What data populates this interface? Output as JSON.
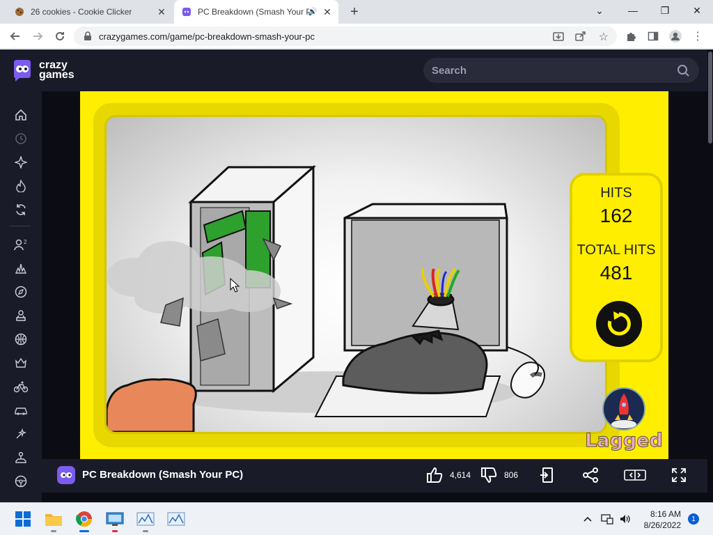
{
  "browser": {
    "tabs": [
      {
        "title": "26 cookies - Cookie Clicker",
        "active": false
      },
      {
        "title": "PC Breakdown (Smash Your PC)",
        "active": true
      }
    ],
    "url": "crazygames.com/game/pc-breakdown-smash-your-pc"
  },
  "site": {
    "logo_line1": "crazy",
    "logo_line2": "games",
    "search_placeholder": "Search",
    "sidebar_icons": [
      "home-icon",
      "clock-icon",
      "sparkle-icon",
      "fire-icon",
      "refresh-icon",
      "multiplayer-icon",
      "action-icon",
      "compass-icon",
      "trophy-icon",
      "basketball-icon",
      "crown-icon",
      "bike-icon",
      "car-icon",
      "puzzle-icon",
      "joystick-icon",
      "steering-icon"
    ]
  },
  "game": {
    "hits_label": "HITS",
    "hits_value": "162",
    "total_hits_label": "TOTAL HITS",
    "total_hits_value": "481",
    "publisher_logo": "Lagged"
  },
  "gamebar": {
    "title": "PC Breakdown (Smash Your PC)",
    "likes": "4,614",
    "dislikes": "806"
  },
  "taskbar": {
    "time": "8:16 AM",
    "date": "8/26/2022",
    "notifications": "1"
  },
  "colors": {
    "site_dark": "#1a1b28",
    "game_yellow": "#ffee00",
    "brand_purple": "#7b5bf0"
  }
}
